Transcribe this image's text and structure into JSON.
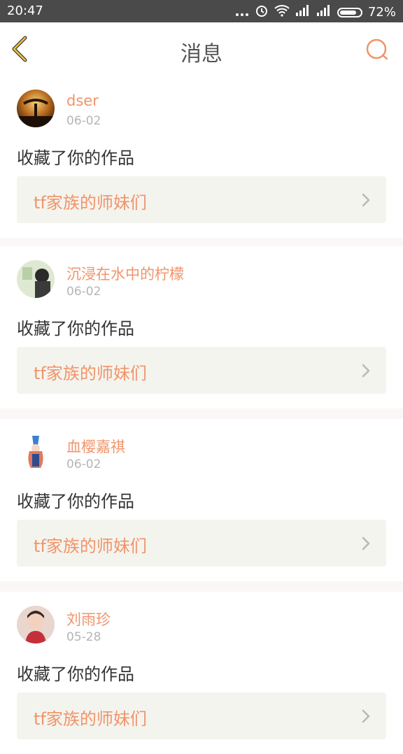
{
  "status_bar": {
    "time": "20:47",
    "battery": "72%",
    "battery_level": 0.72
  },
  "nav": {
    "title": "消息",
    "back_icon": "chevron-left-icon",
    "search_icon": "search-icon"
  },
  "colors": {
    "accent": "#f0946a",
    "back": "#f0c23a",
    "card_bg": "#f4f4ee"
  },
  "messages": [
    {
      "user": "dser",
      "date": "06-02",
      "action": "收藏了你的作品",
      "work": "tf家族的师妹们"
    },
    {
      "user": "沉浸在水中的柠檬",
      "date": "06-02",
      "action": "收藏了你的作品",
      "work": "tf家族的师妹们"
    },
    {
      "user": "血樱嘉祺",
      "date": "06-02",
      "action": "收藏了你的作品",
      "work": "tf家族的师妹们"
    },
    {
      "user": "刘雨珍",
      "date": "05-28",
      "action": "收藏了你的作品",
      "work": "tf家族的师妹们"
    }
  ]
}
